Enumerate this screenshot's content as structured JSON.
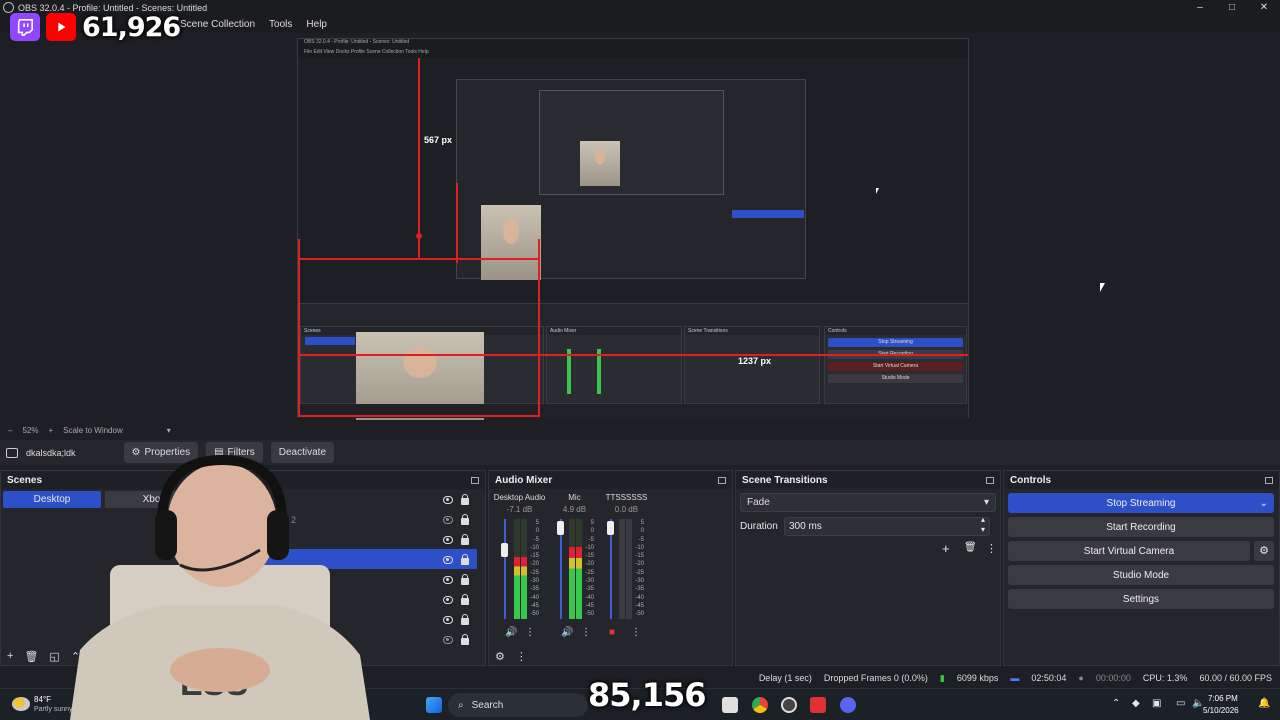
{
  "window": {
    "title": "OBS 32.0.4 - Profile: Untitled - Scenes: Untitled",
    "controls": [
      "–",
      "□",
      "✕"
    ]
  },
  "menu": {
    "items": [
      "Scene Collection",
      "Tools",
      "Help"
    ]
  },
  "overlay": {
    "viewer_count": "61,926",
    "bottom_count": "85,156"
  },
  "nested_preview": {
    "measure_height": "567 px",
    "measure_width": "1237 px",
    "inner_measure": "1237 px",
    "inner_measure_v": "567 px",
    "controls": [
      "Stop Streaming",
      "Start Recording",
      "Start Virtual Camera",
      "Studio Mode",
      "Settings"
    ]
  },
  "zoom": {
    "level": "52%",
    "scale_label": "Scale to Window"
  },
  "source_bar": {
    "source_name": "dkalsdka;ldk",
    "properties_label": "Properties",
    "filters_label": "Filters",
    "deactivate_label": "Deactivate"
  },
  "scenes": {
    "title": "Scenes",
    "items": [
      "Desktop",
      "Xbox"
    ],
    "hidden_label": "ture 2"
  },
  "audio_mixer": {
    "title": "Audio Mixer",
    "channels": [
      {
        "name": "Desktop Audio",
        "db": "-7.1 dB",
        "level": 0.62
      },
      {
        "name": "Mic",
        "db": "4.9 dB",
        "level": 0.72
      },
      {
        "name": "TTSSSSSS",
        "db": "0.0 dB",
        "level": 0.0
      }
    ],
    "scale": [
      "5",
      "0",
      "-5",
      "-10",
      "-15",
      "-20",
      "-25",
      "-30",
      "-35",
      "-40",
      "-45",
      "-50",
      "-55",
      "-60"
    ]
  },
  "transitions": {
    "title": "Scene Transitions",
    "type": "Fade",
    "duration_label": "Duration",
    "duration_value": "300 ms"
  },
  "controls": {
    "title": "Controls",
    "stop_streaming": "Stop Streaming",
    "start_recording": "Start Recording",
    "start_virtual_camera": "Start Virtual Camera",
    "studio_mode": "Studio Mode",
    "settings": "Settings"
  },
  "status": {
    "delay": "Delay (1 sec)",
    "dropped": "Dropped Frames 0 (0.0%)",
    "bitrate": "6099 kbps",
    "stream_time": "02:50:04",
    "rec_time": "00:00:00",
    "cpu": "CPU: 1.3%",
    "fps": "60.00 / 60.00 FPS"
  },
  "taskbar": {
    "weather_temp": "84°F",
    "weather_desc": "Partly sunny",
    "search_label": "Search",
    "time": "7:06 PM",
    "date": "5/10/2026"
  },
  "colors": {
    "accent": "#2d50c8",
    "bg": "#1e1f24",
    "dock": "#25262b",
    "button": "#3a3b42",
    "measure_red": "#e02020"
  }
}
